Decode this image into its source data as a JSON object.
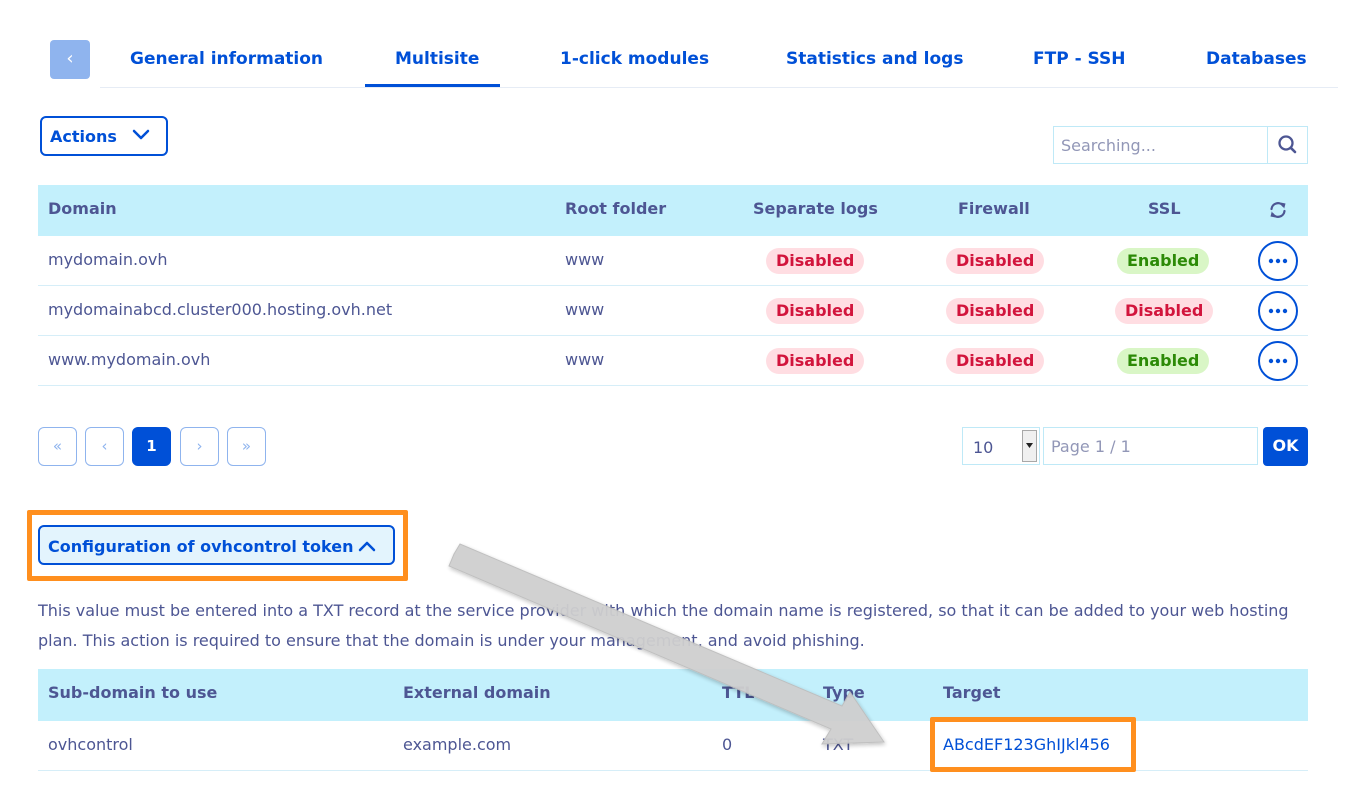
{
  "tabs": {
    "back_label": "‹",
    "items": [
      {
        "label": "General information"
      },
      {
        "label": "Multisite"
      },
      {
        "label": "1-click modules"
      },
      {
        "label": "Statistics and logs"
      },
      {
        "label": "FTP - SSH"
      },
      {
        "label": "Databases"
      }
    ],
    "active": "Multisite"
  },
  "toolbar": {
    "actions_label": "Actions",
    "search_placeholder": "Searching..."
  },
  "multisite_table": {
    "headers": [
      "Domain",
      "Root folder",
      "Separate logs",
      "Firewall",
      "SSL"
    ],
    "rows": [
      {
        "domain": "mydomain.ovh",
        "root": "www",
        "logs": "Disabled",
        "firewall": "Disabled",
        "ssl": "Enabled"
      },
      {
        "domain": "mydomainabcd.cluster000.hosting.ovh.net",
        "root": "www",
        "logs": "Disabled",
        "firewall": "Disabled",
        "ssl": "Disabled"
      },
      {
        "domain": "www.mydomain.ovh",
        "root": "www",
        "logs": "Disabled",
        "firewall": "Disabled",
        "ssl": "Enabled"
      }
    ]
  },
  "pagination": {
    "first": "«",
    "prev": "‹",
    "current": "1",
    "next": "›",
    "last": "»",
    "page_size": "10",
    "page_placeholder": "Page 1 / 1",
    "ok_label": "OK"
  },
  "config": {
    "toggle_label": "Configuration of ovhcontrol token",
    "description": "This value must be entered into a TXT record at the service provider with which the domain name is registered, so that it can be added to your web hosting plan. This action is required to ensure that the domain is under your management, and avoid phishing.",
    "table": {
      "headers": [
        "Sub-domain to use",
        "External domain",
        "TTL",
        "Type",
        "Target"
      ],
      "row": {
        "subdomain": "ovhcontrol",
        "external": "example.com",
        "ttl": "0",
        "type": "TXT",
        "target": "ABcdEF123GhIJkl456"
      }
    }
  },
  "colors": {
    "accent": "#0050d7",
    "header_bg": "#c3f0fc",
    "highlight": "#ff8f1e",
    "disabled_text": "#d2143c",
    "enabled_text": "#2c8a07"
  }
}
